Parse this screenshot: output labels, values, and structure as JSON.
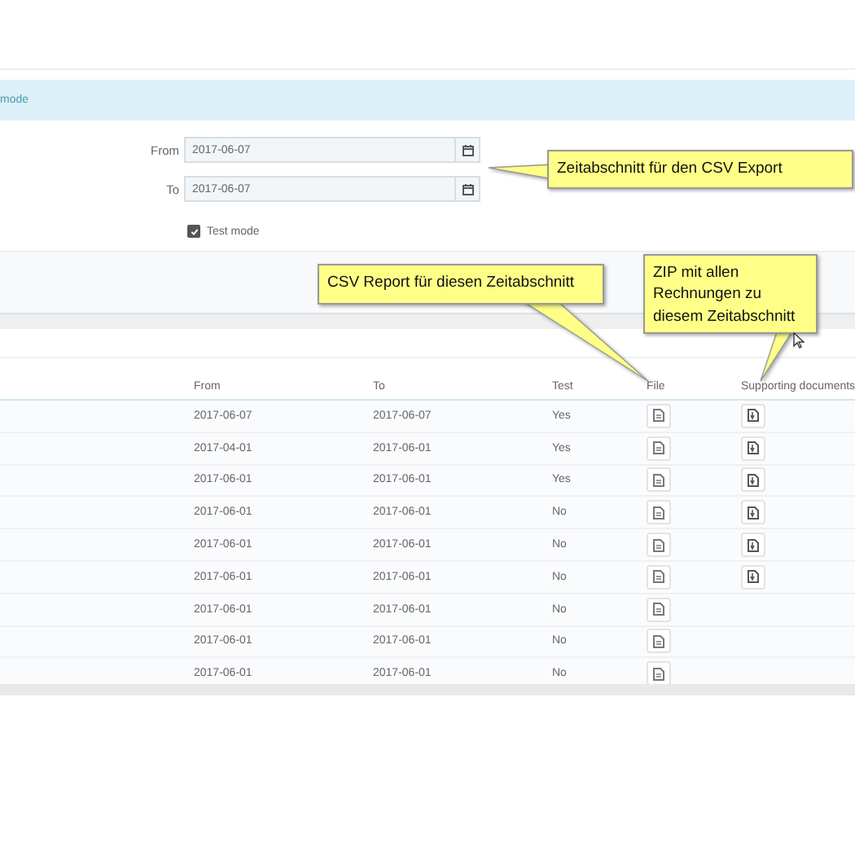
{
  "info_bar": {
    "text": "mode"
  },
  "form": {
    "from": {
      "label": "From",
      "value": "2017-06-07"
    },
    "to": {
      "label": "To",
      "value": "2017-06-07"
    },
    "test_mode": {
      "label": "Test mode",
      "checked": true
    }
  },
  "table": {
    "columns": [
      "From",
      "To",
      "Test",
      "File",
      "Supporting documents"
    ],
    "rows": [
      {
        "from": "2017-06-07",
        "to": "2017-06-07",
        "test": "Yes",
        "supporting_document": true
      },
      {
        "from": "2017-04-01",
        "to": "2017-06-01",
        "test": "Yes",
        "supporting_document": true
      },
      {
        "from": "2017-06-01",
        "to": "2017-06-01",
        "test": "Yes",
        "supporting_document": true
      },
      {
        "from": "2017-06-01",
        "to": "2017-06-01",
        "test": "No",
        "supporting_document": true
      },
      {
        "from": "2017-06-01",
        "to": "2017-06-01",
        "test": "No",
        "supporting_document": true
      },
      {
        "from": "2017-06-01",
        "to": "2017-06-01",
        "test": "No",
        "supporting_document": true
      },
      {
        "from": "2017-06-01",
        "to": "2017-06-01",
        "test": "No",
        "supporting_document": false
      },
      {
        "from": "2017-06-01",
        "to": "2017-06-01",
        "test": "No",
        "supporting_document": false
      },
      {
        "from": "2017-06-01",
        "to": "2017-06-01",
        "test": "No",
        "supporting_document": false
      }
    ]
  },
  "callouts": [
    {
      "text": "Zeitabschnitt für den CSV Export"
    },
    {
      "text": "CSV Report für diesen Zeitabschnitt"
    },
    {
      "text": "ZIP mit allen Rechnungen zu diesem Zeitabschnitt"
    }
  ]
}
